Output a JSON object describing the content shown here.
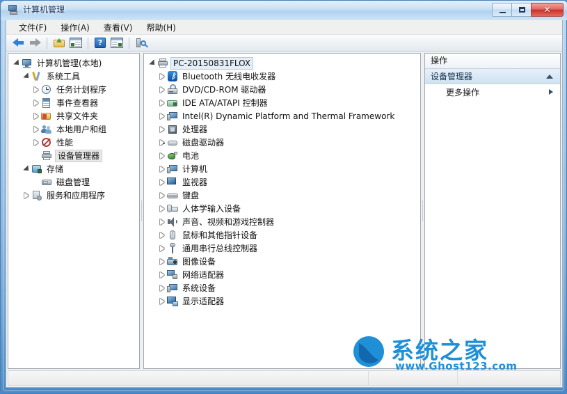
{
  "window": {
    "title": "计算机管理",
    "icon": "computer-management-icon",
    "minimize_label": "–",
    "maximize_label": "□",
    "close_label": "✕"
  },
  "menu": [
    {
      "label": "文件(F)",
      "name": "menu-file"
    },
    {
      "label": "操作(A)",
      "name": "menu-action"
    },
    {
      "label": "查看(V)",
      "name": "menu-view"
    },
    {
      "label": "帮助(H)",
      "name": "menu-help"
    }
  ],
  "toolbar": [
    {
      "name": "back-button",
      "icon": "back-arrow-icon"
    },
    {
      "name": "forward-button",
      "icon": "forward-arrow-icon"
    },
    {
      "name": "up-one-level-button",
      "icon": "folder-up-icon"
    },
    {
      "name": "show-hide-console-tree-button",
      "icon": "console-tree-icon"
    },
    {
      "name": "help-button",
      "icon": "help-icon"
    },
    {
      "name": "show-hide-action-pane-button",
      "icon": "action-pane-icon"
    },
    {
      "name": "scan-hardware-changes-button",
      "icon": "scan-hardware-icon"
    }
  ],
  "left_tree": [
    {
      "label": "计算机管理(本地)",
      "icon": "computer-icon",
      "level": 0,
      "expander": "open",
      "selected": false
    },
    {
      "label": "系统工具",
      "icon": "tools-icon",
      "level": 1,
      "expander": "open",
      "selected": false
    },
    {
      "label": "任务计划程序",
      "icon": "clock-icon",
      "level": 2,
      "expander": "closed",
      "selected": false
    },
    {
      "label": "事件查看器",
      "icon": "event-log-icon",
      "level": 2,
      "expander": "closed",
      "selected": false
    },
    {
      "label": "共享文件夹",
      "icon": "shared-folder-icon",
      "level": 2,
      "expander": "closed",
      "selected": false
    },
    {
      "label": "本地用户和组",
      "icon": "users-icon",
      "level": 2,
      "expander": "closed",
      "selected": false
    },
    {
      "label": "性能",
      "icon": "performance-icon",
      "level": 2,
      "expander": "closed",
      "selected": false
    },
    {
      "label": "设备管理器",
      "icon": "device-manager-icon",
      "level": 2,
      "expander": "none",
      "selected": true
    },
    {
      "label": "存储",
      "icon": "storage-icon",
      "level": 1,
      "expander": "open",
      "selected": false
    },
    {
      "label": "磁盘管理",
      "icon": "disk-management-icon",
      "level": 2,
      "expander": "none",
      "selected": false
    },
    {
      "label": "服务和应用程序",
      "icon": "services-icon",
      "level": 1,
      "expander": "closed",
      "selected": false
    }
  ],
  "device_tree": {
    "root": {
      "label": "PC-20150831FLOX",
      "icon": "computer-node-icon",
      "expander": "open",
      "selected": true
    },
    "items": [
      {
        "label": "Bluetooth 无线电收发器",
        "icon": "bluetooth-icon"
      },
      {
        "label": "DVD/CD-ROM 驱动器",
        "icon": "dvd-drive-icon"
      },
      {
        "label": "IDE ATA/ATAPI 控制器",
        "icon": "ide-controller-icon"
      },
      {
        "label": "Intel(R) Dynamic Platform and Thermal Framework",
        "icon": "system-device-icon"
      },
      {
        "label": "处理器",
        "icon": "processor-icon"
      },
      {
        "label": "磁盘驱动器",
        "icon": "disk-drive-icon"
      },
      {
        "label": "电池",
        "icon": "battery-icon"
      },
      {
        "label": "计算机",
        "icon": "computer-device-icon"
      },
      {
        "label": "监视器",
        "icon": "monitor-icon"
      },
      {
        "label": "键盘",
        "icon": "keyboard-icon"
      },
      {
        "label": "人体学输入设备",
        "icon": "hid-icon"
      },
      {
        "label": "声音、视频和游戏控制器",
        "icon": "sound-icon"
      },
      {
        "label": "鼠标和其他指针设备",
        "icon": "mouse-icon"
      },
      {
        "label": "通用串行总线控制器",
        "icon": "usb-icon"
      },
      {
        "label": "图像设备",
        "icon": "imaging-device-icon"
      },
      {
        "label": "网络适配器",
        "icon": "network-adapter-icon"
      },
      {
        "label": "系统设备",
        "icon": "system-devices-icon"
      },
      {
        "label": "显示适配器",
        "icon": "display-adapter-icon"
      }
    ]
  },
  "actions_pane": {
    "title": "操作",
    "group_label": "设备管理器",
    "collapse_icon": "chevron-up-icon",
    "items": [
      {
        "label": "更多操作",
        "submenu_icon": "chevron-right-icon"
      }
    ]
  },
  "status_bar": {
    "main": "",
    "cell2": "",
    "cell3": ""
  },
  "watermark": {
    "brand": "系统之家",
    "url": "www.Ghost123.com",
    "logo_icon": "ghost123-logo-icon",
    "color": "#1f8fd6"
  },
  "colors": {
    "accent": "#1f8fd6",
    "title_bar": "#cbe2f6",
    "frame": "#5b8fc9",
    "selection": "#e4eef9",
    "close_button": "#c8322a"
  }
}
